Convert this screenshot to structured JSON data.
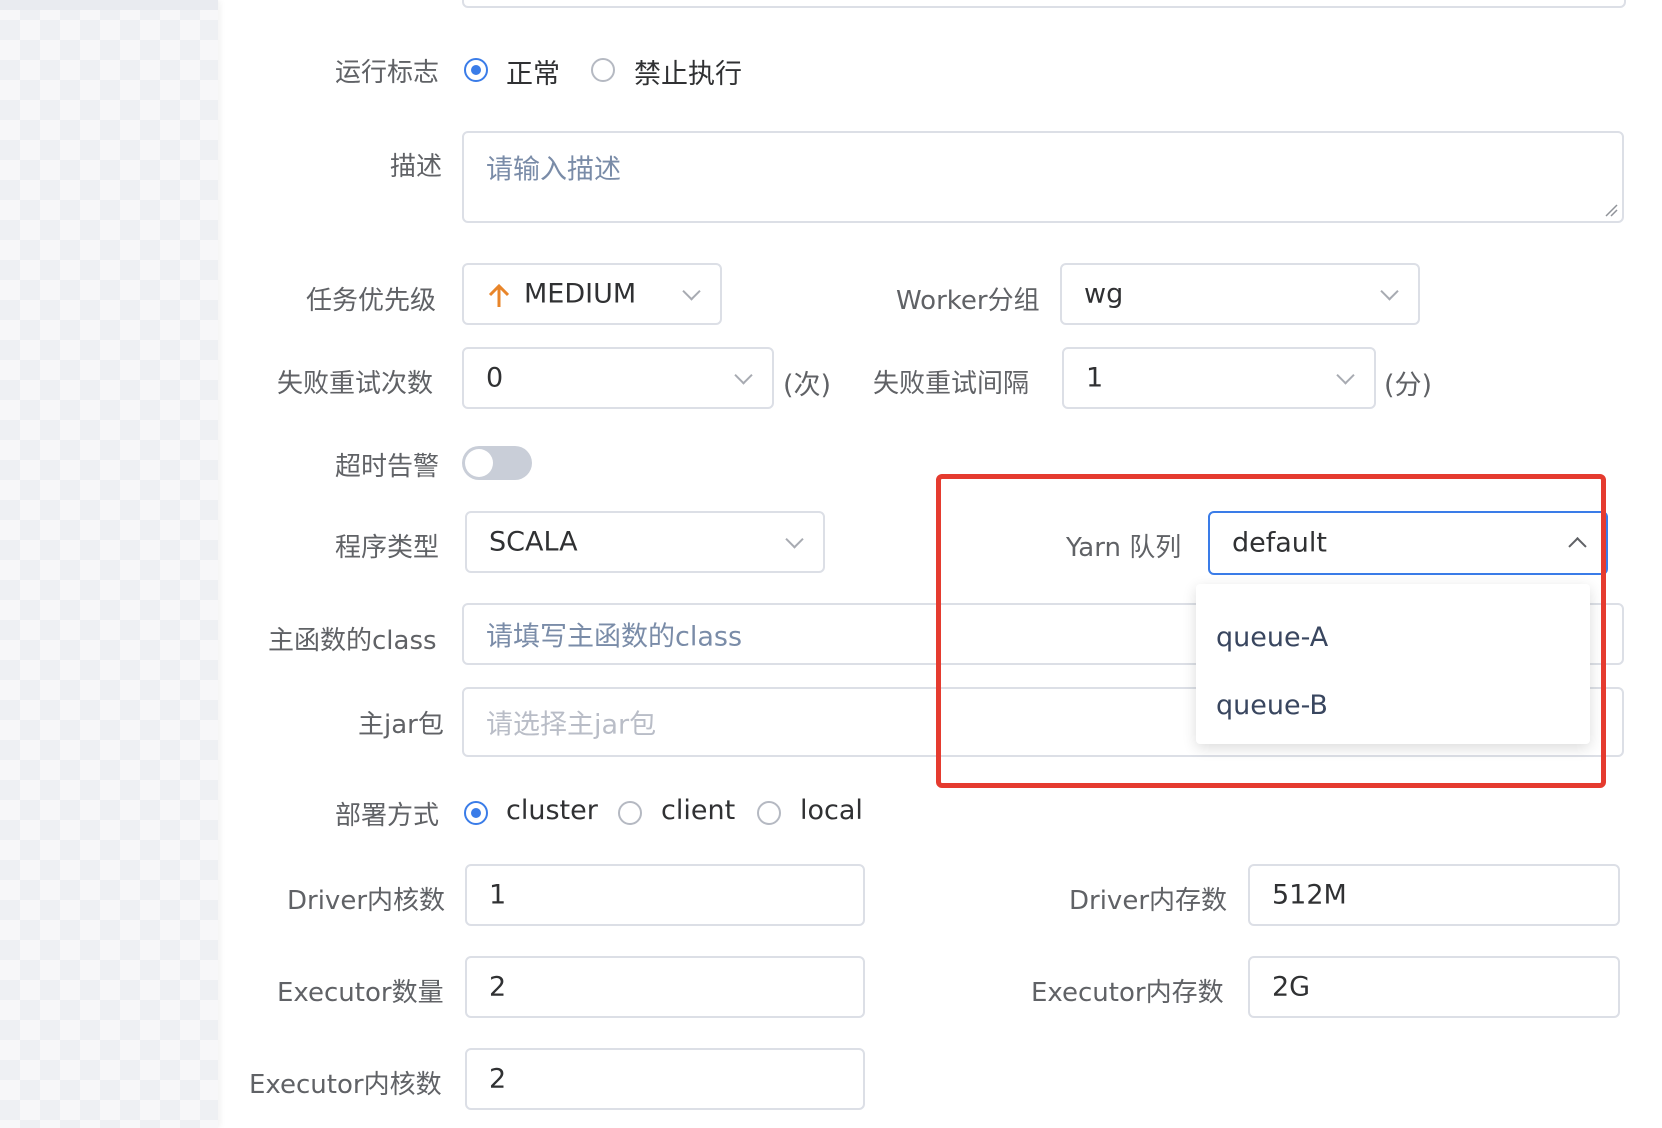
{
  "form": {
    "run_flag": {
      "label": "运行标志",
      "options": [
        "正常",
        "禁止执行"
      ],
      "selected": "正常"
    },
    "description": {
      "label": "描述",
      "placeholder": "请输入描述"
    },
    "priority": {
      "label": "任务优先级",
      "value": "MEDIUM"
    },
    "worker_group": {
      "label": "Worker分组",
      "value": "wg"
    },
    "retry_times": {
      "label": "失败重试次数",
      "value": "0",
      "unit": "(次)"
    },
    "retry_interval": {
      "label": "失败重试间隔",
      "value": "1",
      "unit": "(分)"
    },
    "timeout_alert": {
      "label": "超时告警",
      "on": false
    },
    "program_type": {
      "label": "程序类型",
      "value": "SCALA"
    },
    "yarn_queue": {
      "label": "Yarn 队列",
      "value": "default",
      "options": [
        "queue-A",
        "queue-B"
      ]
    },
    "main_class": {
      "label": "主函数的class",
      "placeholder": "请填写主函数的class"
    },
    "main_jar": {
      "label": "主jar包",
      "placeholder": "请选择主jar包"
    },
    "deploy_mode": {
      "label": "部署方式",
      "options": [
        "cluster",
        "client",
        "local"
      ],
      "selected": "cluster"
    },
    "driver_cores": {
      "label": "Driver内核数",
      "value": "1"
    },
    "driver_memory": {
      "label": "Driver内存数",
      "value": "512M"
    },
    "executor_count": {
      "label": "Executor数量",
      "value": "2"
    },
    "executor_memory": {
      "label": "Executor内存数",
      "value": "2G"
    },
    "executor_cores": {
      "label": "Executor内核数",
      "value": "2"
    }
  },
  "colors": {
    "accent": "#3a7ce8",
    "highlight": "#e53b2f",
    "priority_arrow": "#e8852a"
  }
}
